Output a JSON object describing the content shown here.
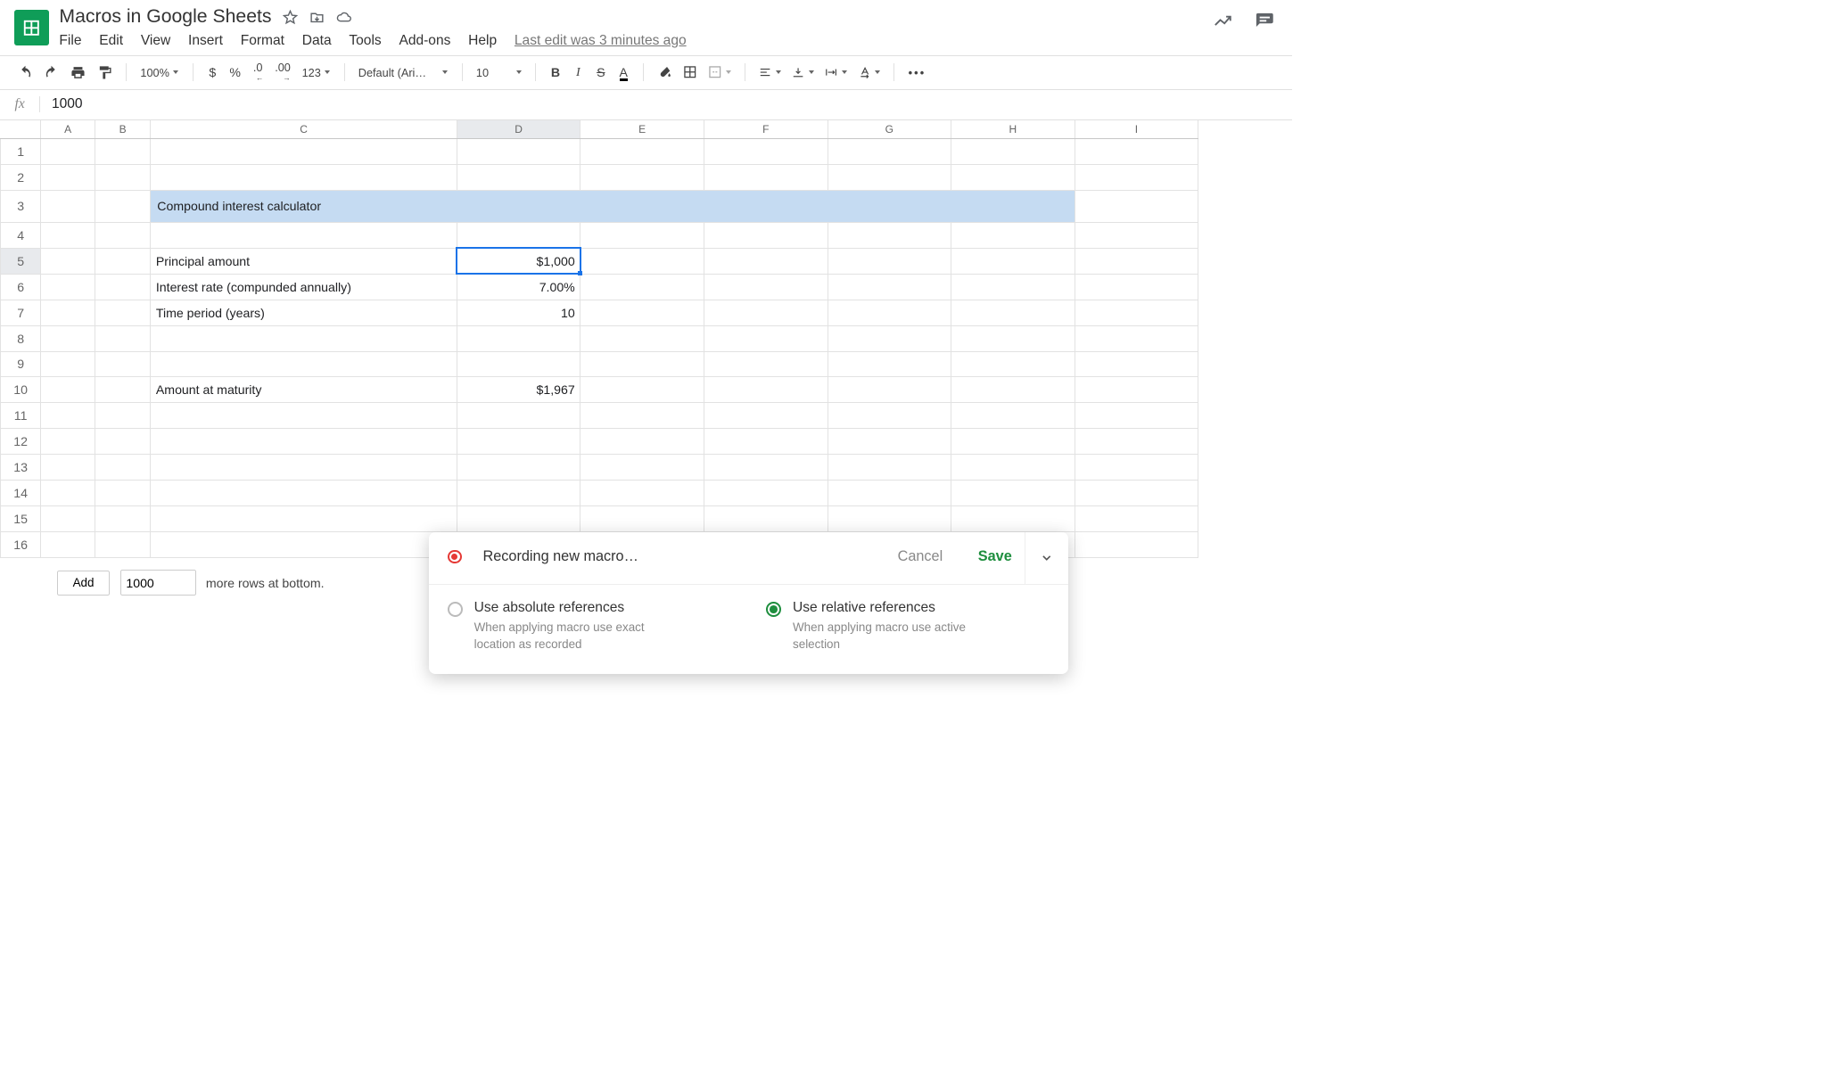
{
  "doc": {
    "title": "Macros in Google Sheets"
  },
  "menu": {
    "file": "File",
    "edit": "Edit",
    "view": "View",
    "insert": "Insert",
    "format": "Format",
    "data": "Data",
    "tools": "Tools",
    "addons": "Add-ons",
    "help": "Help",
    "last_edit": "Last edit was 3 minutes ago"
  },
  "toolbar": {
    "zoom": "100%",
    "currency_symbol": "$",
    "percent_symbol": "%",
    "dec_less": ".0",
    "dec_more": ".00",
    "num_format": "123",
    "font_name": "Default (Ari…",
    "font_size": "10",
    "bold": "B",
    "italic": "I",
    "strike": "S",
    "text_color": "A"
  },
  "formula": {
    "fx": "fx",
    "value": "1000"
  },
  "grid": {
    "columns": [
      "A",
      "B",
      "C",
      "D",
      "E",
      "F",
      "G",
      "H",
      "I"
    ],
    "rows": [
      "1",
      "2",
      "3",
      "4",
      "5",
      "6",
      "7",
      "8",
      "9",
      "10",
      "11",
      "12",
      "13",
      "14",
      "15",
      "16"
    ],
    "selected": {
      "col": "D",
      "row": "5"
    },
    "cells": {
      "C3": "Compound interest calculator",
      "C5": "Principal amount",
      "D5": "$1,000",
      "C6": "Interest rate (compunded annually)",
      "D6": "7.00%",
      "C7": "Time period (years)",
      "D7": "10",
      "C10": "Amount at maturity",
      "D10": "$1,967"
    }
  },
  "addrows": {
    "button": "Add",
    "count": "1000",
    "suffix": "more rows at bottom."
  },
  "macro": {
    "title": "Recording new macro…",
    "cancel": "Cancel",
    "save": "Save",
    "opt_abs": {
      "title": "Use absolute references",
      "desc": "When applying macro use exact location as recorded"
    },
    "opt_rel": {
      "title": "Use relative references",
      "desc": "When applying macro use active selection"
    },
    "selected": "relative"
  }
}
